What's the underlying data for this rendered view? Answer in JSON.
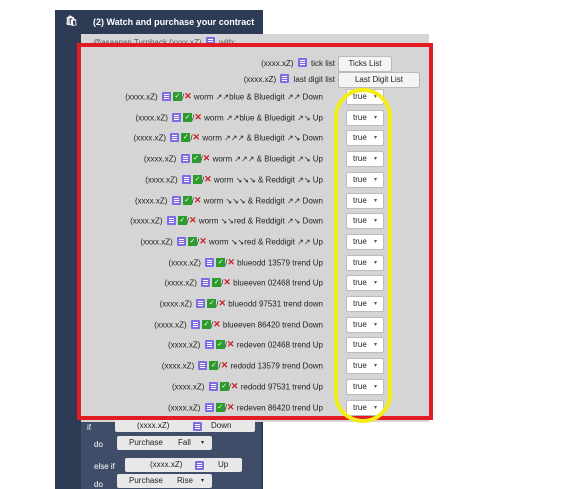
{
  "header": {
    "title": "(2) Watch and purchase your contract",
    "icon": "shopping-bag-icon"
  },
  "trigger_row": {
    "text": "@asaanan Turnback (xxxx.xZ)",
    "suffix": "with:"
  },
  "list_buttons": [
    {
      "label": "(xxxx.xZ)",
      "item": "tick list",
      "button": "Ticks List"
    },
    {
      "label": "(xxxx.xZ)",
      "item": "last digit list",
      "button": "Last Digit List"
    }
  ],
  "conditions": [
    {
      "label": "(xxxx.xZ)",
      "text": "worm ↗↗blue & Bluedigit ↗↗ Down",
      "value": "true"
    },
    {
      "label": "(xxxx.xZ)",
      "text": "worm ↗↗blue & Bluedigit ↗↘ Up",
      "value": "true"
    },
    {
      "label": "(xxxx.xZ)",
      "text": "worm ↗↗↗ & Bluedigit ↗↘ Down",
      "value": "true"
    },
    {
      "label": "(xxxx.xZ)",
      "text": "worm ↗↗↗ & Bluedigit ↗↘ Up",
      "value": "true"
    },
    {
      "label": "(xxxx.xZ)",
      "text": "worm ↘↘↘ & Reddigit ↗↘ Up",
      "value": "true"
    },
    {
      "label": "(xxxx.xZ)",
      "text": "worm ↘↘↘ & Reddigit ↗↗ Down",
      "value": "true"
    },
    {
      "label": "(xxxx.xZ)",
      "text": "worm ↘↘red & Reddigit ↗↘ Down",
      "value": "true"
    },
    {
      "label": "(xxxx.xZ)",
      "text": "worm ↘↘red & Reddigit ↗↗ Up",
      "value": "true"
    },
    {
      "label": "(xxxx.xZ)",
      "text": "blueodd 13579 trend Up",
      "value": "true"
    },
    {
      "label": "(xxxx.xZ)",
      "text": "blueeven 02468 trend Up",
      "value": "true"
    },
    {
      "label": "(xxxx.xZ)",
      "text": "blueodd 97531 trend down",
      "value": "true"
    },
    {
      "label": "(xxxx.xZ)",
      "text": "blueeven 86420 trend Down",
      "value": "true"
    },
    {
      "label": "(xxxx.xZ)",
      "text": "redeven 02468 trend Up",
      "value": "true"
    },
    {
      "label": "(xxxx.xZ)",
      "text": "redodd 13579 trend Down",
      "value": "true"
    },
    {
      "label": "(xxxx.xZ)",
      "text": "redodd 97531 trend Up",
      "value": "true"
    },
    {
      "label": "(xxxx.xZ)",
      "text": "redeven 86420 trend Up",
      "value": "true"
    }
  ],
  "lower": {
    "if_kw": "if",
    "if_text": "(xxxx.xZ)",
    "if_dir": "Down",
    "do1_kw": "do",
    "do1_action": "Purchase",
    "do1_value": "Fall",
    "elseif_kw": "else if",
    "elseif_text": "(xxxx.xZ)",
    "elseif_dir": "Up",
    "do2_kw": "do",
    "do2_action": "Purchase",
    "do2_value": "Rise"
  },
  "colors": {
    "highlight_box": "#e31b23",
    "highlight_oval": "#f4ee16",
    "block": "#2e3b55"
  }
}
